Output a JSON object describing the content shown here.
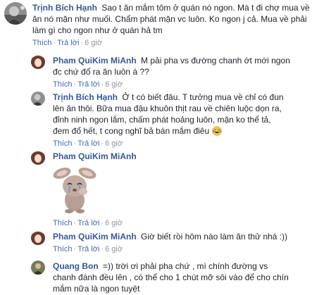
{
  "comments": [
    {
      "author": "Trịnh Bích Hạnh",
      "text": "Sao t ăn mắm tôm ở quán nó ngon. Mà t đi chợ mua về ăn nó mặn như muối. Chẩm phát mặn vc luôn. Ko ngon j cả. Mua về phải làm gì cho ngon như ở quán hả tm",
      "like": "Thích",
      "reply": "Trả lời",
      "time": "6 giờ"
    },
    {
      "author": "Pham QuiKim MiAnh",
      "text": "M pải pha vs đường chanh ớt mới ngon đc chứ đổ ra ăn luôn á ??",
      "like": "Thích",
      "reply": "Trả lời",
      "time": "6 giờ"
    },
    {
      "author": "Trịnh Bích Hạnh",
      "text": "Ở t có biết đâu. T tưởng mua về chỉ có đun lên ăn thôi. Bữa mua đậu khuôn thịt rau về chiên luộc dọn ra, đỉnh ninh ngon lắm, chấm phát hoảng luôn, mặn ko thể tả, đem đổ hết, t cong nghĩ bả bán mắm điêu",
      "emoji": "laughing-tears-emoji",
      "like": "Thích",
      "reply": "Trả lời",
      "time": "6 giờ"
    },
    {
      "author": "Pham QuiKim MiAnh",
      "sticker": "crying-bunny-sticker",
      "like": "Thích",
      "reply": "Trả lời",
      "time": "6 giờ"
    },
    {
      "author": "Pham QuiKim MiAnh",
      "text": "Giờ biết rồi hôm nào làm ăn thử nhá :))",
      "like": "Thích",
      "reply": "Trả lời",
      "time": "6 giờ"
    },
    {
      "author": "Quang Bon",
      "text": "=)) trời ơi phải pha chứ , mì chính đường vs chanh đánh đều lên , có thể cho 1 chút mỡ sôi vào để cho chín mắm nữa là ngon tuyệt",
      "like": "",
      "reply": "",
      "time": ""
    }
  ],
  "separator": "·",
  "colors": {
    "author": "#365899",
    "link": "#4267b2",
    "meta": "#90949c",
    "text": "#1d2129"
  }
}
